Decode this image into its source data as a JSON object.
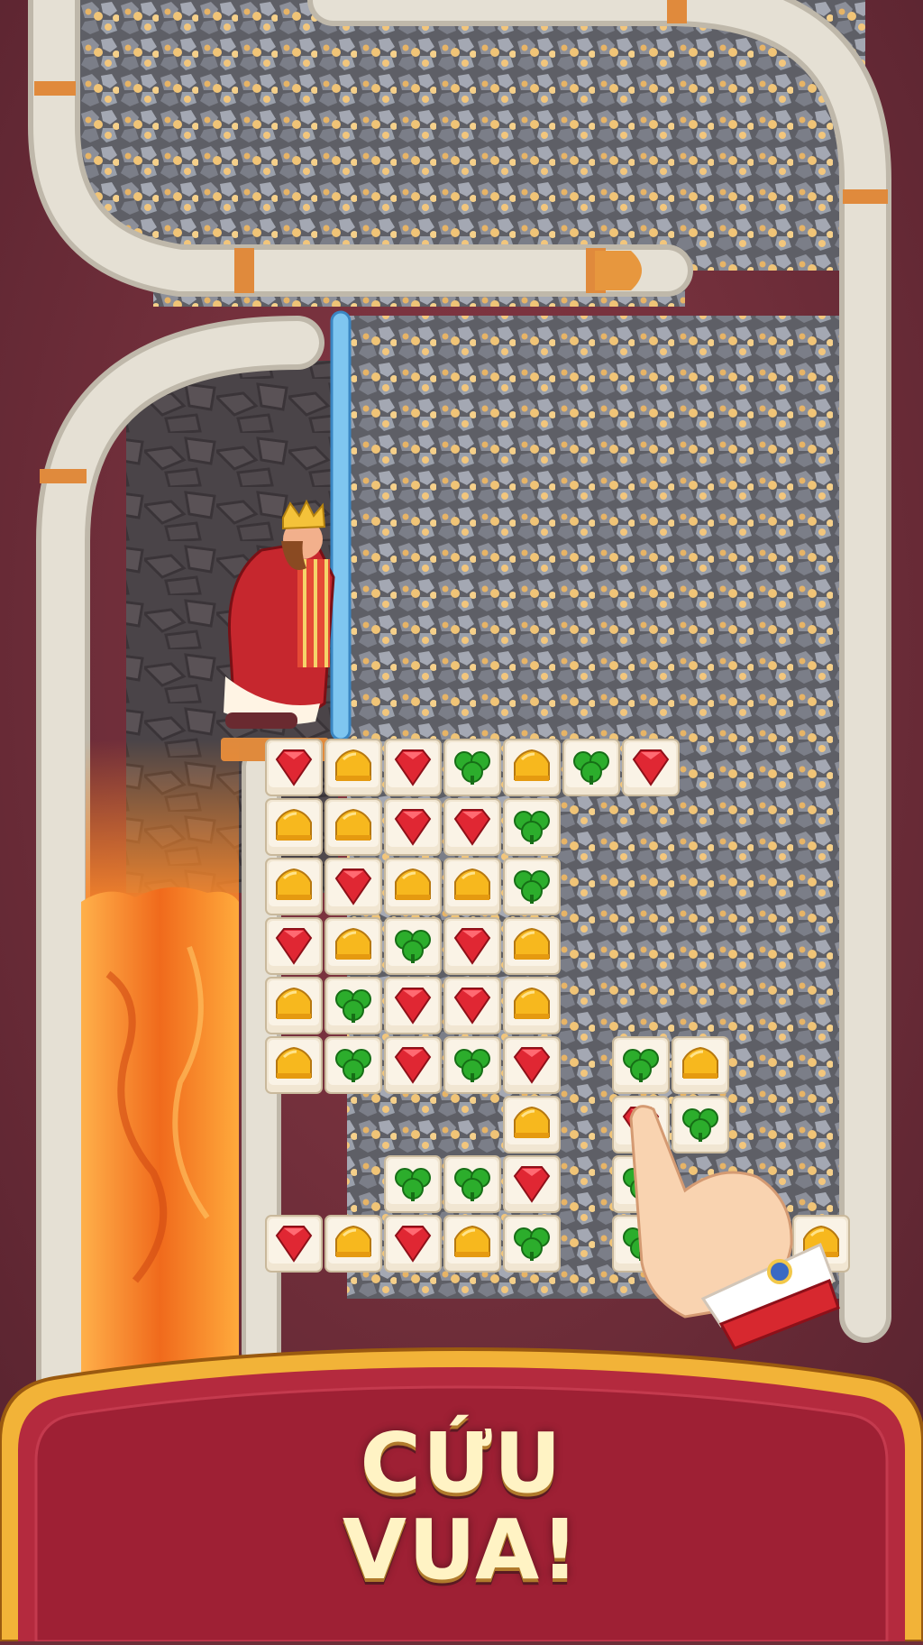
{
  "banner": {
    "line1": "CỨU",
    "line2": "VUA!"
  },
  "colors": {
    "background": "#6e2e38",
    "pipe": "#d9d4c8",
    "pipe_joint": "#e08a3c",
    "lava": "#f07a24",
    "banner_fill": "#b42a3e",
    "banner_border": "#f2b338",
    "caption_text": "#fff3c4",
    "pin": "#7fc6f0"
  },
  "tile_legend": {
    "R": "red-gem",
    "Y": "yellow-crown",
    "G": "green-clover"
  },
  "board": {
    "left_grid": [
      [
        "R",
        "Y",
        "R",
        "G",
        "Y",
        "G",
        "R"
      ],
      [
        "Y",
        "Y",
        "R",
        "R",
        "G",
        "",
        ""
      ],
      [
        "Y",
        "R",
        "Y",
        "Y",
        "G",
        "",
        ""
      ],
      [
        "R",
        "Y",
        "G",
        "R",
        "Y",
        "",
        ""
      ],
      [
        "Y",
        "G",
        "R",
        "R",
        "Y",
        "",
        ""
      ],
      [
        "Y",
        "G",
        "R",
        "G",
        "R",
        "",
        ""
      ],
      [
        "",
        "",
        "",
        "",
        "Y",
        "",
        ""
      ],
      [
        "",
        "",
        "G",
        "G",
        "R",
        "",
        ""
      ],
      [
        "R",
        "Y",
        "R",
        "Y",
        "G",
        "",
        ""
      ]
    ],
    "right_grid": [
      [
        "G",
        "Y"
      ],
      [
        "R",
        "G"
      ],
      [
        "G",
        ""
      ],
      [
        "G",
        ""
      ]
    ],
    "extra_tile": "Y"
  },
  "characters": {
    "king": "king-character",
    "hand": "tutorial-pointer-hand"
  }
}
